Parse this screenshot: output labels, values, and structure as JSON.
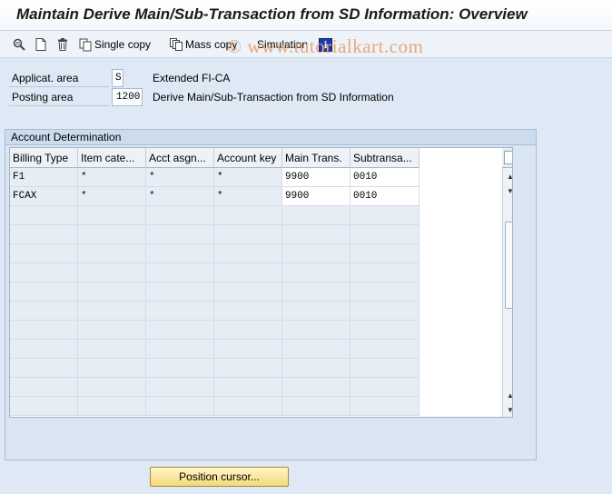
{
  "title": "Maintain Derive Main/Sub-Transaction from SD Information: Overview",
  "watermark": "© www.tutorialkart.com",
  "toolbar": {
    "single_copy_label": "Single copy",
    "mass_copy_label": "Mass copy",
    "simulation_label": "Simulation",
    "info_glyph": "i",
    "icons": [
      "details-icon",
      "new-document-icon",
      "delete-icon",
      "single-copy-icon",
      "mass-copy-icon",
      "info-icon"
    ]
  },
  "fields": {
    "applic_area": {
      "label": "Applicat. area",
      "value": "S",
      "description": "Extended FI-CA"
    },
    "posting_area": {
      "label": "Posting area",
      "value": "1200",
      "description": "Derive Main/Sub-Transaction from SD Information"
    }
  },
  "group": {
    "title": "Account Determination"
  },
  "table": {
    "columns": [
      "Billing Type",
      "Item cate...",
      "Acct asgn...",
      "Account key",
      "Main Trans.",
      "Subtransa..."
    ],
    "rows": [
      [
        "F1",
        "*",
        "*",
        "*",
        "9900",
        "0010"
      ],
      [
        "FCAX",
        "*",
        "*",
        "*",
        "9900",
        "0010"
      ]
    ],
    "empty_rows": 11
  },
  "position_button_label": "Position cursor...",
  "colors": {
    "accent_button": "#f3d97a",
    "info_badge": "#1d3ca8",
    "background": "#dfe9f5"
  }
}
